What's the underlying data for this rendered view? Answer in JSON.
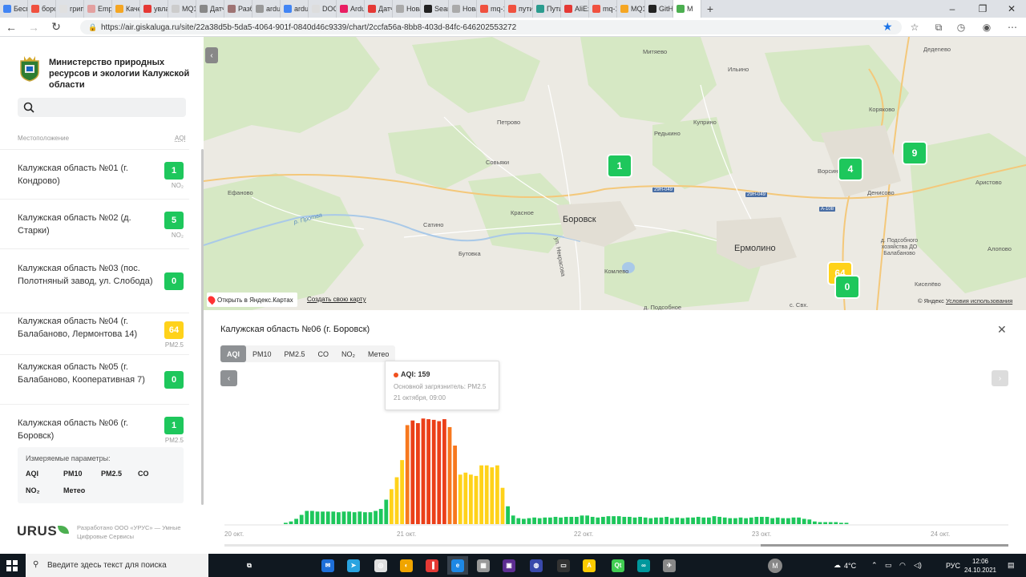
{
  "browser": {
    "tabs": [
      {
        "label": "Бесп",
        "color": "#4285f4"
      },
      {
        "label": "борс",
        "color": "#f0513f"
      },
      {
        "label": "грип",
        "color": "#e0e0e0"
      },
      {
        "label": "Emp",
        "color": "#e3a0a0"
      },
      {
        "label": "Каче",
        "color": "#f5a623"
      },
      {
        "label": "увла",
        "color": "#e53935"
      },
      {
        "label": "MQ1",
        "color": "#cccccc"
      },
      {
        "label": "Датч",
        "color": "#888888"
      },
      {
        "label": "Разб",
        "color": "#9e7373"
      },
      {
        "label": "ardui",
        "color": "#999999"
      },
      {
        "label": "ardu",
        "color": "#4285f4"
      },
      {
        "label": "DOC",
        "color": "#dddddd"
      },
      {
        "label": "Ardu",
        "color": "#e91e63"
      },
      {
        "label": "Датч",
        "color": "#e53935"
      },
      {
        "label": "Нова",
        "color": "#aaaaaa"
      },
      {
        "label": "Searc",
        "color": "#222222"
      },
      {
        "label": "Нова",
        "color": "#aaaaaa"
      },
      {
        "label": "mq-1",
        "color": "#f0513f"
      },
      {
        "label": "путин",
        "color": "#f0513f"
      },
      {
        "label": "Пути",
        "color": "#2b9c8f"
      },
      {
        "label": "AliEx",
        "color": "#e53935"
      },
      {
        "label": "mq-1",
        "color": "#f0513f"
      },
      {
        "label": "MQ1",
        "color": "#f5a623"
      },
      {
        "label": "GitH",
        "color": "#222222"
      },
      {
        "label": "M",
        "color": "#4caf50"
      }
    ],
    "new_tab_label": "+",
    "url": "https://air.giskaluga.ru/site/22a38d5b-5da5-4064-901f-0840d46c9339/chart/2ccfa56a-8bb8-403d-84fc-646202553272"
  },
  "sidebar": {
    "org_name": "Министерство природных ресурсов и экологии Калужской области",
    "search_placeholder": "",
    "col_location": "Местоположение",
    "col_aqi": "AQI",
    "items": [
      {
        "name": "Калужская область №01 (г. Кондрово)",
        "value": "1",
        "sub": "NO₂",
        "color": "#1ec75c"
      },
      {
        "name": "Калужская область №02 (д. Старки)",
        "value": "5",
        "sub": "NO₂",
        "color": "#1ec75c"
      },
      {
        "name": "Калужская область №03 (пос. Полотняный завод, ул. Слобода)",
        "value": "0",
        "sub": "",
        "color": "#1ec75c"
      },
      {
        "name": "Калужская область №04 (г. Балабаново, Лермонтова 14)",
        "value": "64",
        "sub": "PM2.5",
        "color": "#ffd21a"
      },
      {
        "name": "Калужская область №05 (г. Балабаново, Кооперативная 7)",
        "value": "0",
        "sub": "",
        "color": "#1ec75c"
      },
      {
        "name": "Калужская область №06 (г. Боровск)",
        "value": "1",
        "sub": "PM2.5",
        "color": "#1ec75c"
      }
    ],
    "params_title": "Измеряемые параметры:",
    "params": [
      "AQI",
      "PM10",
      "PM2.5",
      "CO",
      "NO₂",
      "Метео"
    ],
    "brand": "URUS",
    "developer": "Разработано ООО «УРУС» — Умные Цифровые Сервисы"
  },
  "map": {
    "labels": [
      "Митяево",
      "Ильино",
      "Петрово",
      "Редькино",
      "Куприно",
      "Совьяки",
      "Ефаново",
      "Красное",
      "Сатино",
      "Бутовка",
      "Комлево",
      "Ворсино",
      "Денисово",
      "Коряково",
      "Дедеnево",
      "Аристово",
      "Алопово",
      "Киселёво",
      "Ермолино",
      "Боровск",
      "д. Подсобного хозяйства ДО Балабаново",
      "д. Подсобное",
      "с. Свх.",
      "р. Протва",
      "ул. Некрасова"
    ],
    "roads": [
      "29Н-049",
      "29Н-049",
      "А-108"
    ],
    "markers": [
      {
        "value": "1",
        "color": "#1ec75c"
      },
      {
        "value": "4",
        "color": "#1ec75c"
      },
      {
        "value": "9",
        "color": "#1ec75c"
      },
      {
        "value": "64",
        "color": "#ffd21a"
      },
      {
        "value": "0",
        "color": "#1ec75c"
      }
    ],
    "open_in_yandex": "Открыть в Яндекс.Картах",
    "create_map": "Создать свою карту",
    "copyright": "© Яндекс",
    "terms": "Условия использования"
  },
  "panel": {
    "title": "Калужская область №06 (г. Боровск)",
    "tabs": [
      "AQI",
      "PM10",
      "PM2.5",
      "CO",
      "NO₂",
      "Метео"
    ],
    "active_tab": "AQI",
    "tooltip": {
      "value_label": "AQI: 159",
      "pollutant": "Основной загрязнитель: PM2.5",
      "datetime": "21 октября, 09:00",
      "color": "#f0501e"
    }
  },
  "chart_data": {
    "type": "bar",
    "x_tick_labels": [
      "20 окт.",
      "21 окт.",
      "22 окт.",
      "23 окт.",
      "24 окт."
    ],
    "values": [
      2,
      4,
      8,
      14,
      20,
      20,
      19,
      19,
      19,
      19,
      18,
      19,
      19,
      18,
      19,
      18,
      18,
      20,
      23,
      37,
      53,
      71,
      97,
      150,
      157,
      153,
      160,
      159,
      158,
      156,
      159,
      147,
      119,
      75,
      78,
      75,
      73,
      89,
      89,
      86,
      89,
      55,
      27,
      13,
      9,
      8,
      9,
      10,
      9,
      10,
      10,
      11,
      10,
      11,
      11,
      11,
      13,
      13,
      11,
      10,
      11,
      12,
      12,
      12,
      11,
      11,
      10,
      11,
      10,
      9,
      10,
      10,
      11,
      9,
      10,
      9,
      10,
      10,
      11,
      10,
      10,
      12,
      11,
      10,
      9,
      9,
      10,
      9,
      10,
      11,
      11,
      11,
      9,
      10,
      9,
      9,
      10,
      10,
      8,
      7,
      4,
      3,
      3,
      3,
      3,
      2,
      2
    ],
    "colors_by_aqi": {
      "good": "#1ec75c",
      "moderate": "#ffd21a",
      "unhealthy_sensitive": "#f7781e",
      "unhealthy": "#eb3f19"
    },
    "ylim": [
      0,
      170
    ]
  },
  "taskbar": {
    "search_placeholder": "Введите здесь текст для поиска",
    "apps": [
      {
        "label": "⧉",
        "color": "#101820"
      },
      {
        "label": "✉",
        "color": "#1e6fd9"
      },
      {
        "label": "➤",
        "color": "#2aa3e0"
      },
      {
        "label": "◎",
        "color": "#e0e0e0"
      },
      {
        "label": "◐",
        "color": "#f0a500"
      },
      {
        "label": "▐",
        "color": "#e53935"
      },
      {
        "label": "e",
        "color": "#1e88e5"
      },
      {
        "label": "▦",
        "color": "#999999"
      },
      {
        "label": "▣",
        "color": "#5c2d91"
      },
      {
        "label": "◍",
        "color": "#3949ab"
      },
      {
        "label": "▭",
        "color": "#333333"
      },
      {
        "label": "A",
        "color": "#ffcc00"
      },
      {
        "label": "Qt",
        "color": "#41cd52"
      },
      {
        "label": "∞",
        "color": "#00979c"
      },
      {
        "label": "✈",
        "color": "#888888"
      }
    ],
    "avatar": "M",
    "weather": "4°C",
    "lang": "РУС",
    "time": "12:06",
    "date": "24.10.2021"
  }
}
